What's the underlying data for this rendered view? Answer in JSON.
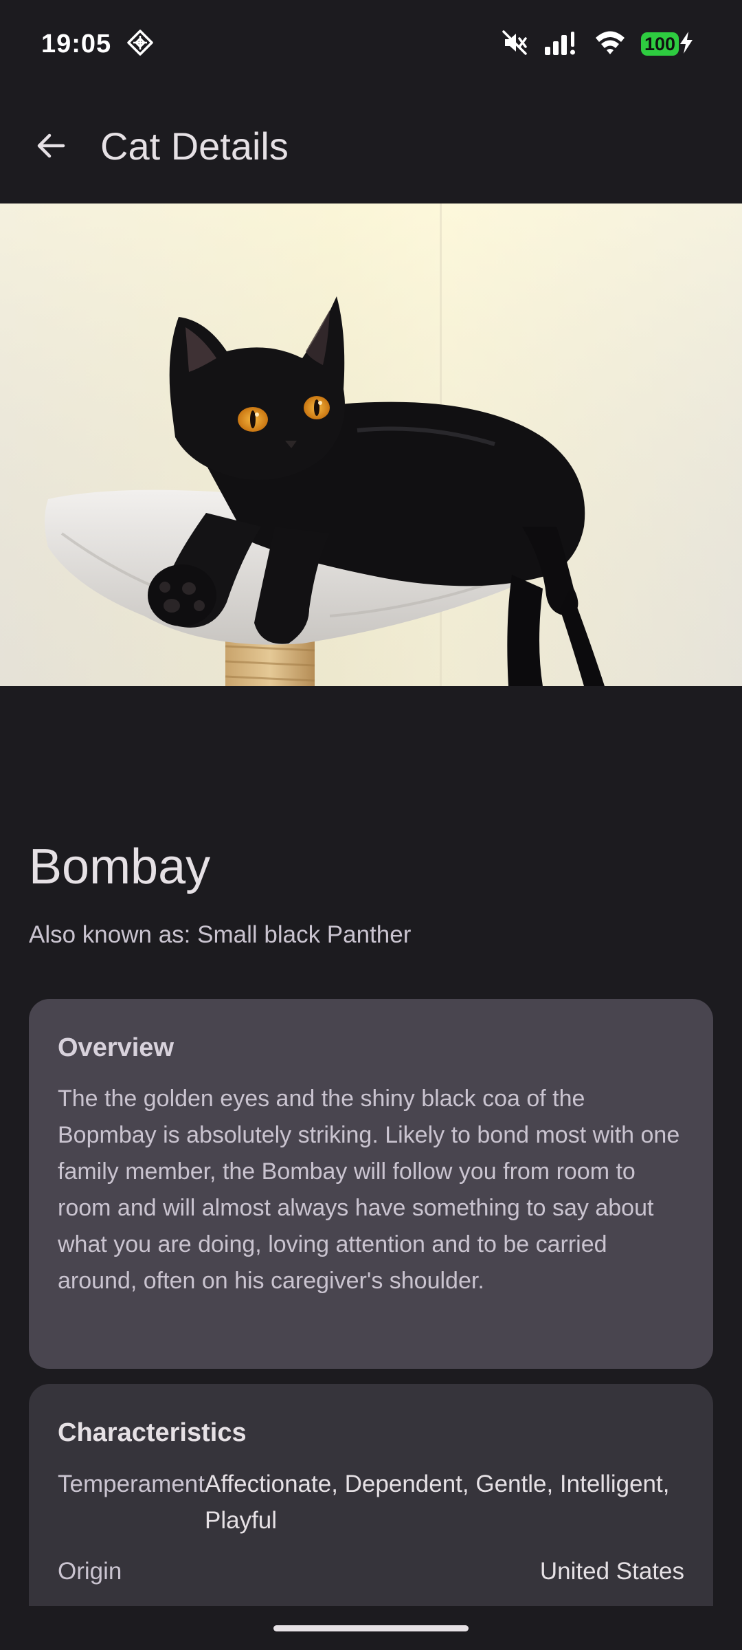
{
  "status_bar": {
    "time": "19:05",
    "battery_level": "100",
    "icons": [
      "diamond-notification-icon",
      "mute-icon",
      "signal-icon",
      "wifi-icon",
      "battery-icon",
      "charging-bolt-icon"
    ]
  },
  "app_bar": {
    "title": "Cat Details",
    "back_icon": "arrow-back-icon"
  },
  "hero_image": {
    "subject": "cat-photo"
  },
  "breed": {
    "name": "Bombay",
    "alt_names": "Also known as: Small black Panther"
  },
  "overview": {
    "title": "Overview",
    "text": "The the golden eyes and the shiny black coa of the Bopmbay is absolutely striking. Likely to bond most with one family member, the Bombay will follow you from room to room and will almost always have something to say about what you are doing, loving attention and to be carried around, often on his caregiver's shoulder."
  },
  "characteristics": {
    "title": "Characteristics",
    "temperament_label": "Temperament",
    "temperament_value": "Affectionate, Dependent, Gentle, Intelligent, Playful",
    "origin_label": "Origin",
    "origin_value": "United States"
  },
  "colors": {
    "background": "#1c1b1f",
    "overview_card": "#49454f",
    "characteristics_card": "#36343b",
    "battery": "#2ecc40"
  }
}
